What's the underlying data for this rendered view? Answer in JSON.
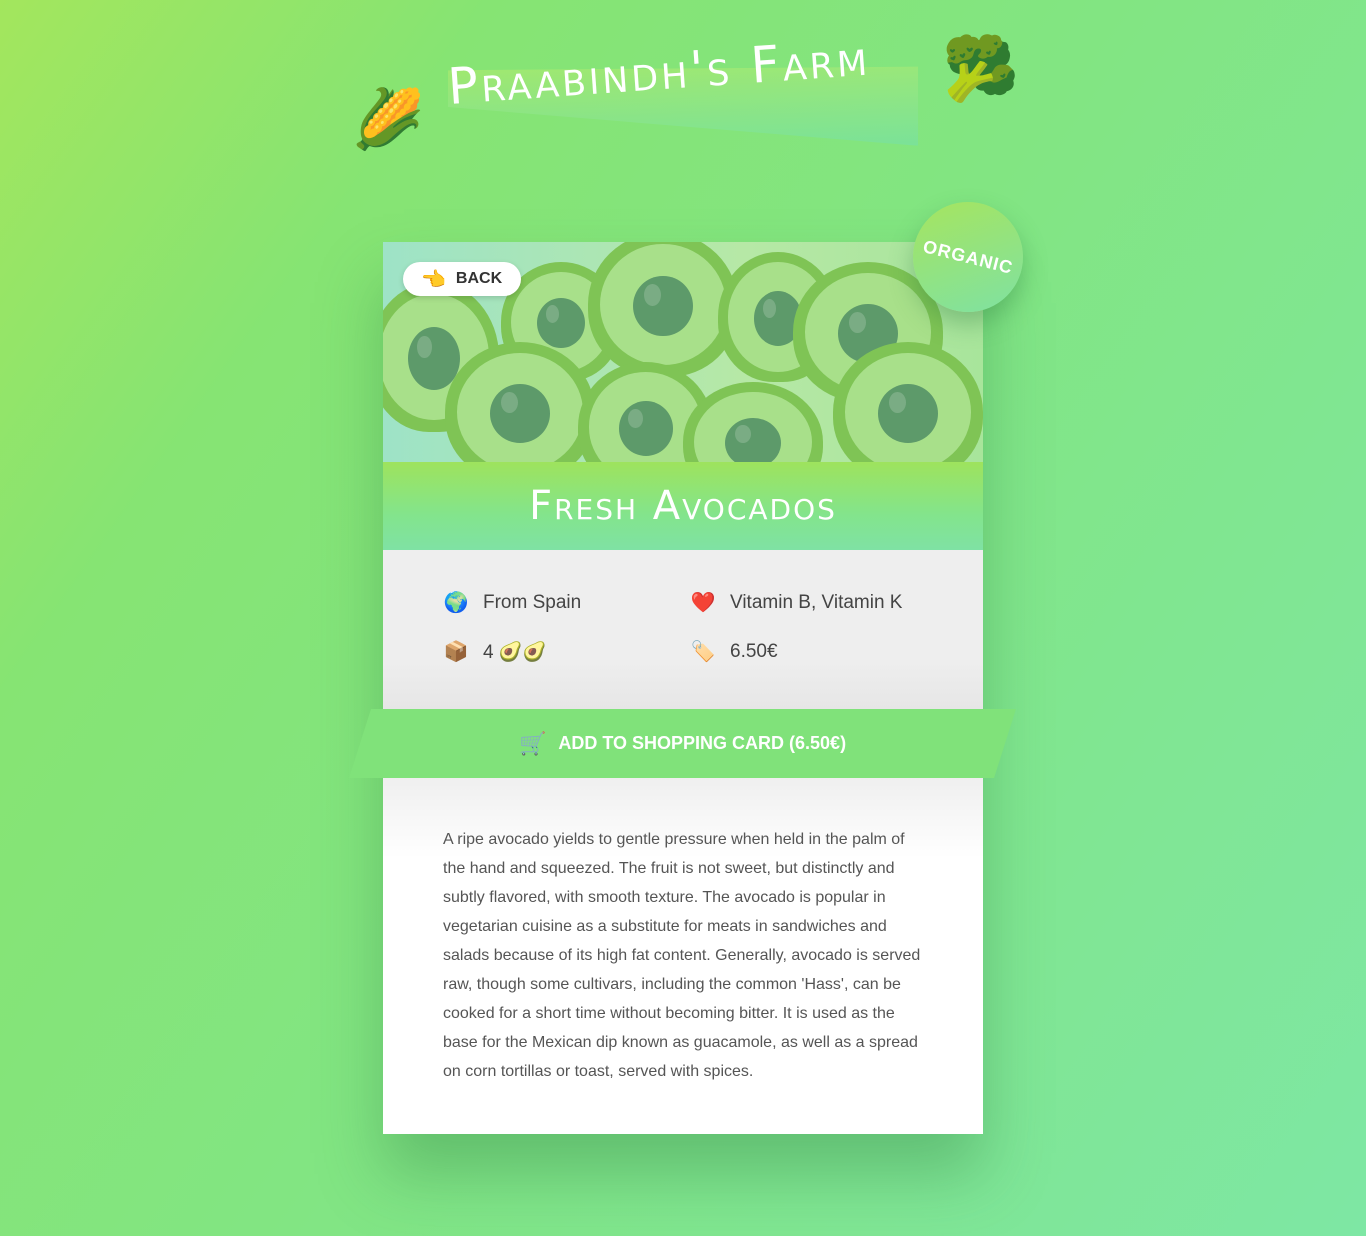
{
  "header": {
    "title": "Praabindh's Farm",
    "left_emoji": "🌽",
    "right_emoji": "🥦"
  },
  "product": {
    "name": "Fresh Avocados",
    "badge": "ORGANIC",
    "back_label": "BACK",
    "back_icon": "👈",
    "origin_icon": "🌍",
    "origin": "From Spain",
    "vitamins_icon": "❤️",
    "vitamins": "Vitamin B, Vitamin K",
    "quantity_icon": "📦",
    "quantity": "4 🥑🥑",
    "price_icon": "🏷️",
    "price": "6.50€",
    "cart_icon": "🛒",
    "cart_label": "ADD TO SHOPPING CARD (6.50€)",
    "description": "A ripe avocado yields to gentle pressure when held in the palm of the hand and squeezed. The fruit is not sweet, but distinctly and subtly flavored, with smooth texture. The avocado is popular in vegetarian cuisine as a substitute for meats in sandwiches and salads because of its high fat content. Generally, avocado is served raw, though some cultivars, including the common 'Hass', can be cooked for a short time without becoming bitter. It is used as the base for the Mexican dip known as guacamole, as well as a spread on corn tortillas or toast, served with spices."
  },
  "colors": {
    "accent_green": "#80e27a",
    "background_start": "#a3e65d",
    "background_end": "#7ee7a4"
  }
}
